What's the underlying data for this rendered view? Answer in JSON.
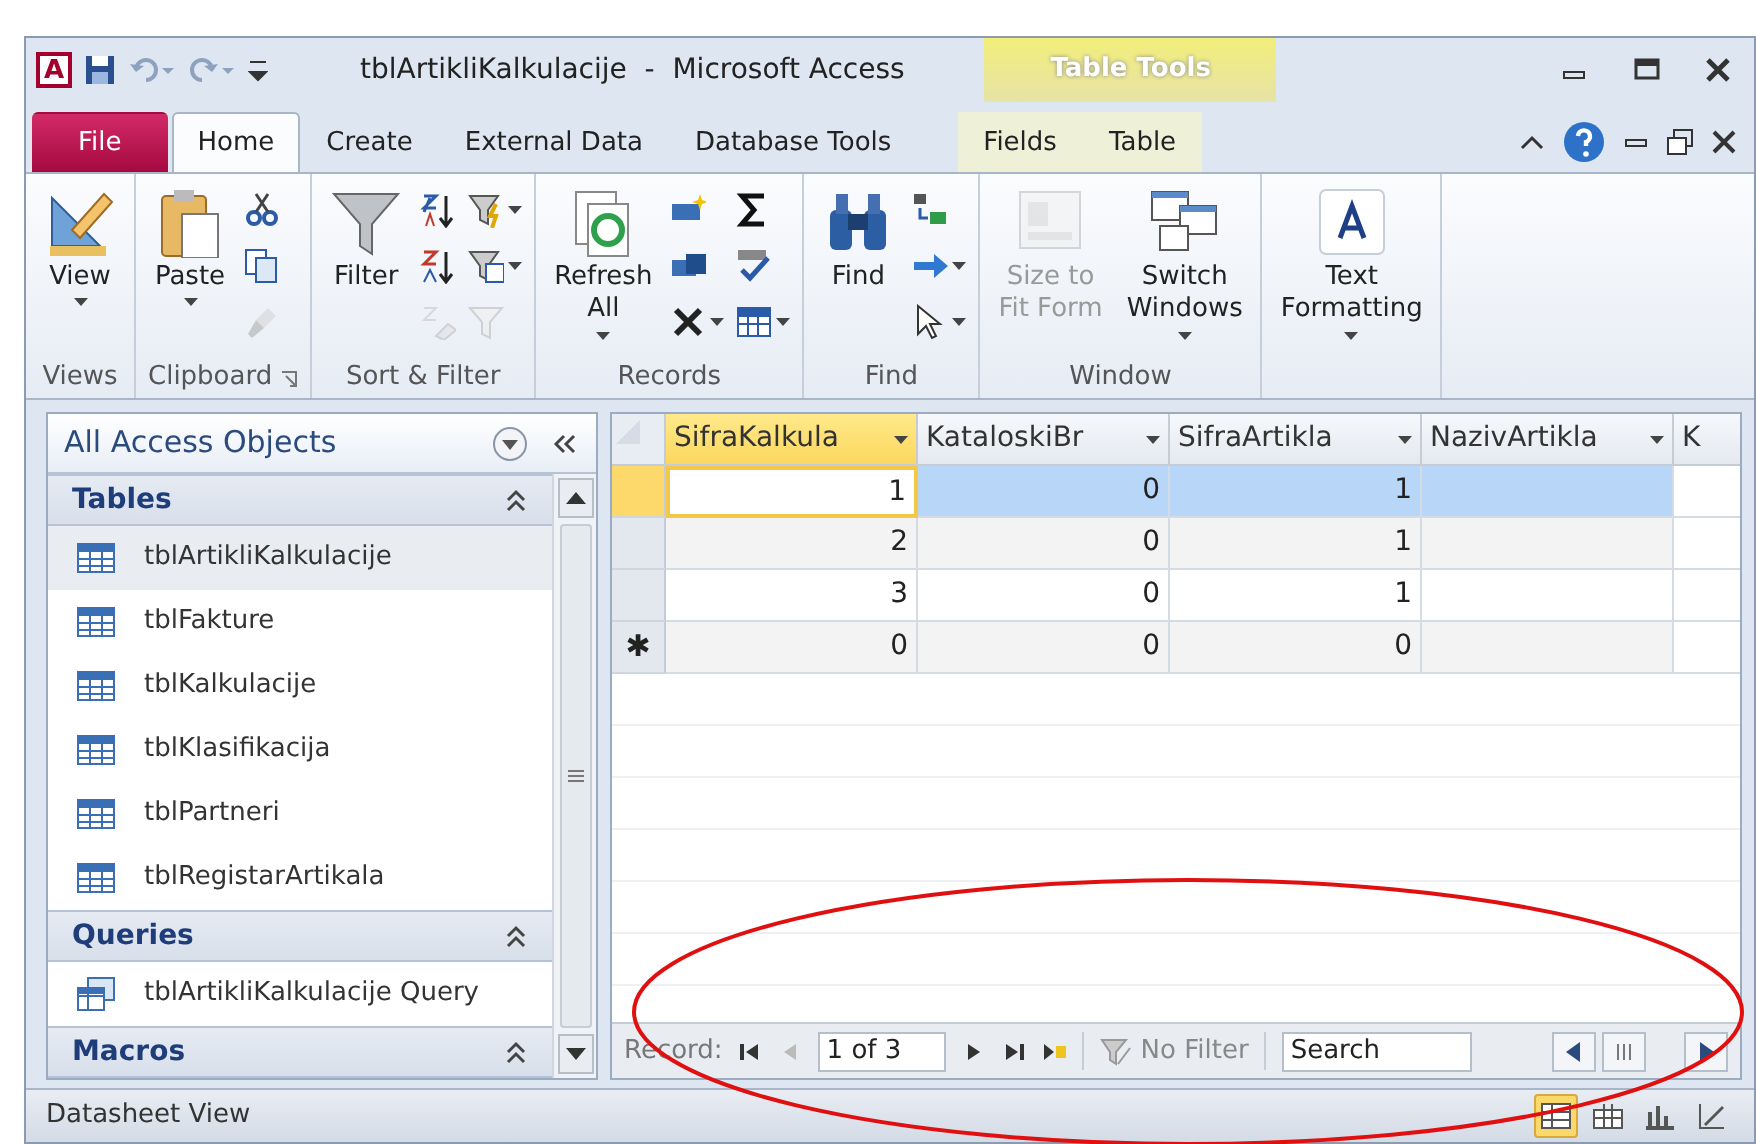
{
  "window": {
    "app_logo": "A",
    "title": "tblArtikliKalkulacije  -  Microsoft Access",
    "contextual_group": "Table Tools"
  },
  "ribbon_tabs": [
    {
      "label": "File",
      "kind": "file",
      "selected": false
    },
    {
      "label": "Home",
      "kind": "normal",
      "selected": true
    },
    {
      "label": "Create",
      "kind": "normal",
      "selected": false
    },
    {
      "label": "External Data",
      "kind": "normal",
      "selected": false
    },
    {
      "label": "Database Tools",
      "kind": "normal",
      "selected": false
    },
    {
      "label": "Fields",
      "kind": "contextual",
      "selected": false
    },
    {
      "label": "Table",
      "kind": "contextual",
      "selected": false
    }
  ],
  "ribbon_groups": [
    {
      "label": "Views",
      "launcher": false,
      "large": {
        "label": "View",
        "kind": "view",
        "dropdown": true,
        "disabled": false
      }
    },
    {
      "label": "Clipboard",
      "launcher": true,
      "large": {
        "label": "Paste",
        "kind": "paste",
        "dropdown": true,
        "disabled": false
      },
      "small_columns": [
        [
          {
            "kind": "cut",
            "dropdown": false,
            "disabled": false
          },
          {
            "kind": "copy",
            "dropdown": false,
            "disabled": false
          },
          {
            "kind": "brush",
            "dropdown": false,
            "disabled": true
          }
        ]
      ]
    },
    {
      "label": "Sort & Filter",
      "launcher": false,
      "large": {
        "label": "Filter",
        "kind": "filter",
        "dropdown": false,
        "disabled": false
      },
      "small_columns": [
        [
          {
            "kind": "sort-asc",
            "dropdown": false,
            "disabled": false
          },
          {
            "kind": "sort-desc",
            "dropdown": false,
            "disabled": false
          },
          {
            "kind": "clear-sort",
            "dropdown": false,
            "disabled": true
          }
        ],
        [
          {
            "kind": "selection",
            "dropdown": true,
            "disabled": false
          },
          {
            "kind": "advanced",
            "dropdown": true,
            "disabled": false
          },
          {
            "kind": "toggle-filter",
            "dropdown": false,
            "disabled": true
          }
        ]
      ]
    },
    {
      "label": "Records",
      "launcher": false,
      "large": {
        "label": "Refresh All",
        "kind": "refresh",
        "dropdown": true,
        "disabled": false
      },
      "small_columns": [
        [
          {
            "kind": "new",
            "dropdown": false,
            "disabled": false
          },
          {
            "kind": "save",
            "dropdown": false,
            "disabled": false
          },
          {
            "kind": "delete",
            "dropdown": true,
            "disabled": false
          }
        ],
        [
          {
            "kind": "totals",
            "dropdown": false,
            "disabled": false
          },
          {
            "kind": "spelling",
            "dropdown": false,
            "disabled": false
          },
          {
            "kind": "more",
            "dropdown": true,
            "disabled": false
          }
        ]
      ]
    },
    {
      "label": "Find",
      "launcher": false,
      "large": {
        "label": "Find",
        "kind": "find",
        "dropdown": false,
        "disabled": false
      },
      "small_columns": [
        [
          {
            "kind": "replace",
            "dropdown": false,
            "disabled": false
          },
          {
            "kind": "goto",
            "dropdown": true,
            "disabled": false
          },
          {
            "kind": "select",
            "dropdown": true,
            "disabled": false
          }
        ]
      ]
    },
    {
      "label": "Window",
      "launcher": false,
      "large": {
        "label": "Size to Fit Form",
        "kind": "fit-form",
        "dropdown": false,
        "disabled": true
      },
      "extra": {
        "label": "Switch Windows",
        "kind": "switch",
        "dropdown": true,
        "disabled": false
      }
    },
    {
      "launcher": false,
      "large": {
        "label": "Text Formatting",
        "kind": "text-format",
        "dropdown": true,
        "disabled": false
      }
    }
  ],
  "nav_pane": {
    "title": "All Access Objects",
    "sections": [
      {
        "label": "Tables",
        "expanded": true,
        "items": [
          {
            "label": "tblArtikliKalkulacije",
            "kind": "table",
            "selected": true
          },
          {
            "label": "tblFakture",
            "kind": "table",
            "selected": false
          },
          {
            "label": "tblKalkulacije",
            "kind": "table",
            "selected": false
          },
          {
            "label": "tblKlasifikacija",
            "kind": "table",
            "selected": false
          },
          {
            "label": "tblPartneri",
            "kind": "table",
            "selected": false
          },
          {
            "label": "tblRegistarArtikala",
            "kind": "table",
            "selected": false
          }
        ]
      },
      {
        "label": "Queries",
        "expanded": true,
        "items": [
          {
            "label": "tblArtikliKalkulacije Query",
            "kind": "query",
            "selected": false
          }
        ]
      },
      {
        "label": "Macros",
        "expanded": true
      }
    ]
  },
  "datasheet": {
    "columns": [
      {
        "label": "SifraKalkula",
        "selected": true
      },
      {
        "label": "KataloskiBr",
        "selected": false
      },
      {
        "label": "SifraArtikla",
        "selected": false
      },
      {
        "label": "NazivArtikla",
        "selected": false
      },
      {
        "label": "K",
        "selected": false
      }
    ],
    "rows": [
      {
        "kind": "record",
        "selected": true,
        "cells": [
          "1",
          "0",
          "1"
        ]
      },
      {
        "kind": "record",
        "selected": false,
        "cells": [
          "2",
          "0",
          "1"
        ]
      },
      {
        "kind": "record",
        "selected": false,
        "cells": [
          "3",
          "0",
          "1"
        ]
      },
      {
        "kind": "new",
        "selected": false,
        "marker": "✱",
        "cells": [
          "0",
          "0",
          "0"
        ]
      }
    ]
  },
  "record_nav": {
    "label": "Record:",
    "position": "1 of 3",
    "filter": "No Filter",
    "search_placeholder": "Search"
  },
  "status_bar": {
    "text": "Datasheet View",
    "views": [
      {
        "kind": "datasheet",
        "selected": true
      },
      {
        "kind": "pivot-table",
        "selected": false
      },
      {
        "kind": "pivot-chart",
        "selected": false
      },
      {
        "kind": "design",
        "selected": false
      }
    ]
  },
  "annotations": [
    {
      "kind": "ellipse"
    }
  ]
}
